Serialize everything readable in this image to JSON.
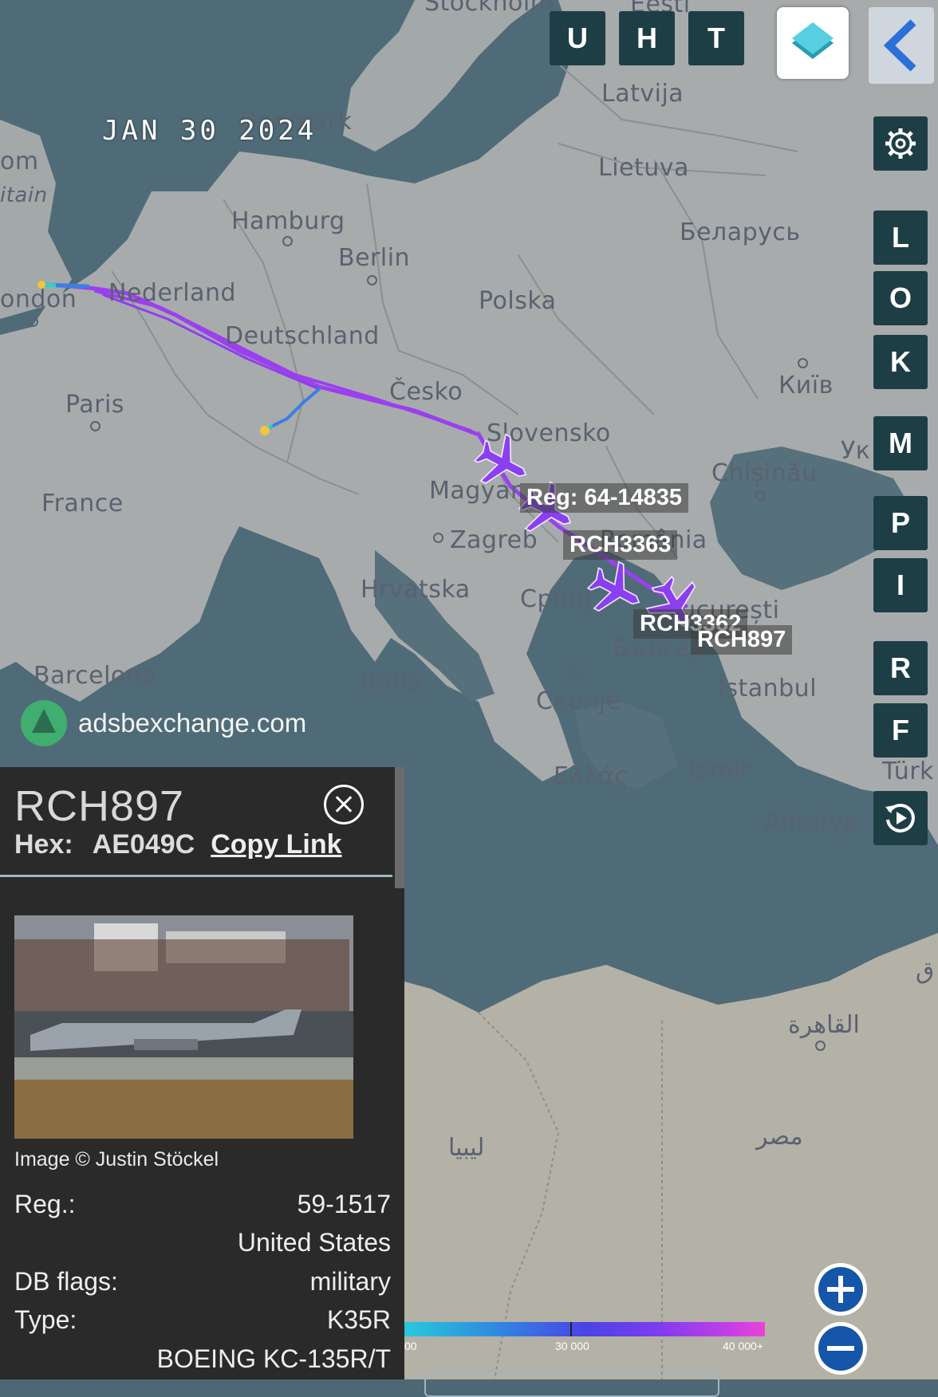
{
  "date": "JAN 30 2024",
  "watermark": "adsbexchange.com",
  "top_buttons": [
    "U",
    "H",
    "T"
  ],
  "side_buttons": [
    "L",
    "O",
    "K",
    "M",
    "P",
    "I",
    "R",
    "F"
  ],
  "map_labels": {
    "stockholm": "Stockholm",
    "eesti": "Eesti",
    "latvija": "Latvija",
    "danmark": "Danmark",
    "lietuva": "Lietuva",
    "om": "om",
    "itain": "itain",
    "hamburg": "Hamburg",
    "berlin": "Berlin",
    "belarus": "Беларусь",
    "london": "ondon",
    "nederland": "Nederland",
    "polska": "Polska",
    "deutschland": "Deutschland",
    "kyiv": "Київ",
    "paris": "Paris",
    "cesko": "Česko",
    "slovensko": "Slovensko",
    "chisinau": "Chișinău",
    "uk": "Ук",
    "france": "France",
    "magyar": "Magyar",
    "zagreb": "Zagreb",
    "romania": "România",
    "hrvatska": "Hrvatska",
    "srbija": "Србиј",
    "bucuresti": "București",
    "bulgaria": "Българ",
    "barcelona": "Barcelona",
    "italia": "Italia",
    "skopje": "Скопје",
    "istanbul": "İstanbul",
    "ellas": "Ελλάς",
    "izmir": "İzmir",
    "turk": "Türk",
    "antalya": "Antalya",
    "cairo": "القاهرة",
    "libya": "ليبيا",
    "misr": "مصر",
    "edge": "ق"
  },
  "planes": [
    {
      "label": "Reg: 64-14835"
    },
    {
      "label": "RCH3363"
    },
    {
      "label": "RCH3362"
    },
    {
      "label": "RCH897"
    }
  ],
  "panel": {
    "callsign": "RCH897",
    "hex_label": "Hex:",
    "hex_value": "AE049C",
    "copy_link": "Copy Link",
    "image_credit": "Image © Justin Stöckel",
    "rows": [
      {
        "key": "Reg.:",
        "value": "59-1517"
      },
      {
        "key": "",
        "value": "United States"
      },
      {
        "key": "DB flags:",
        "value": "military"
      },
      {
        "key": "Type:",
        "value": "K35R"
      },
      {
        "key": "",
        "value": "BOEING KC-135R/T"
      }
    ]
  },
  "altitude_legend": {
    "labels": [
      "00",
      "30 000",
      "40 000+"
    ]
  },
  "icons": [
    "layers-icon",
    "back-arrow-icon",
    "gear-icon",
    "replay-icon",
    "zoom-in-icon",
    "zoom-out-icon",
    "close-icon",
    "aircraft-icon"
  ]
}
